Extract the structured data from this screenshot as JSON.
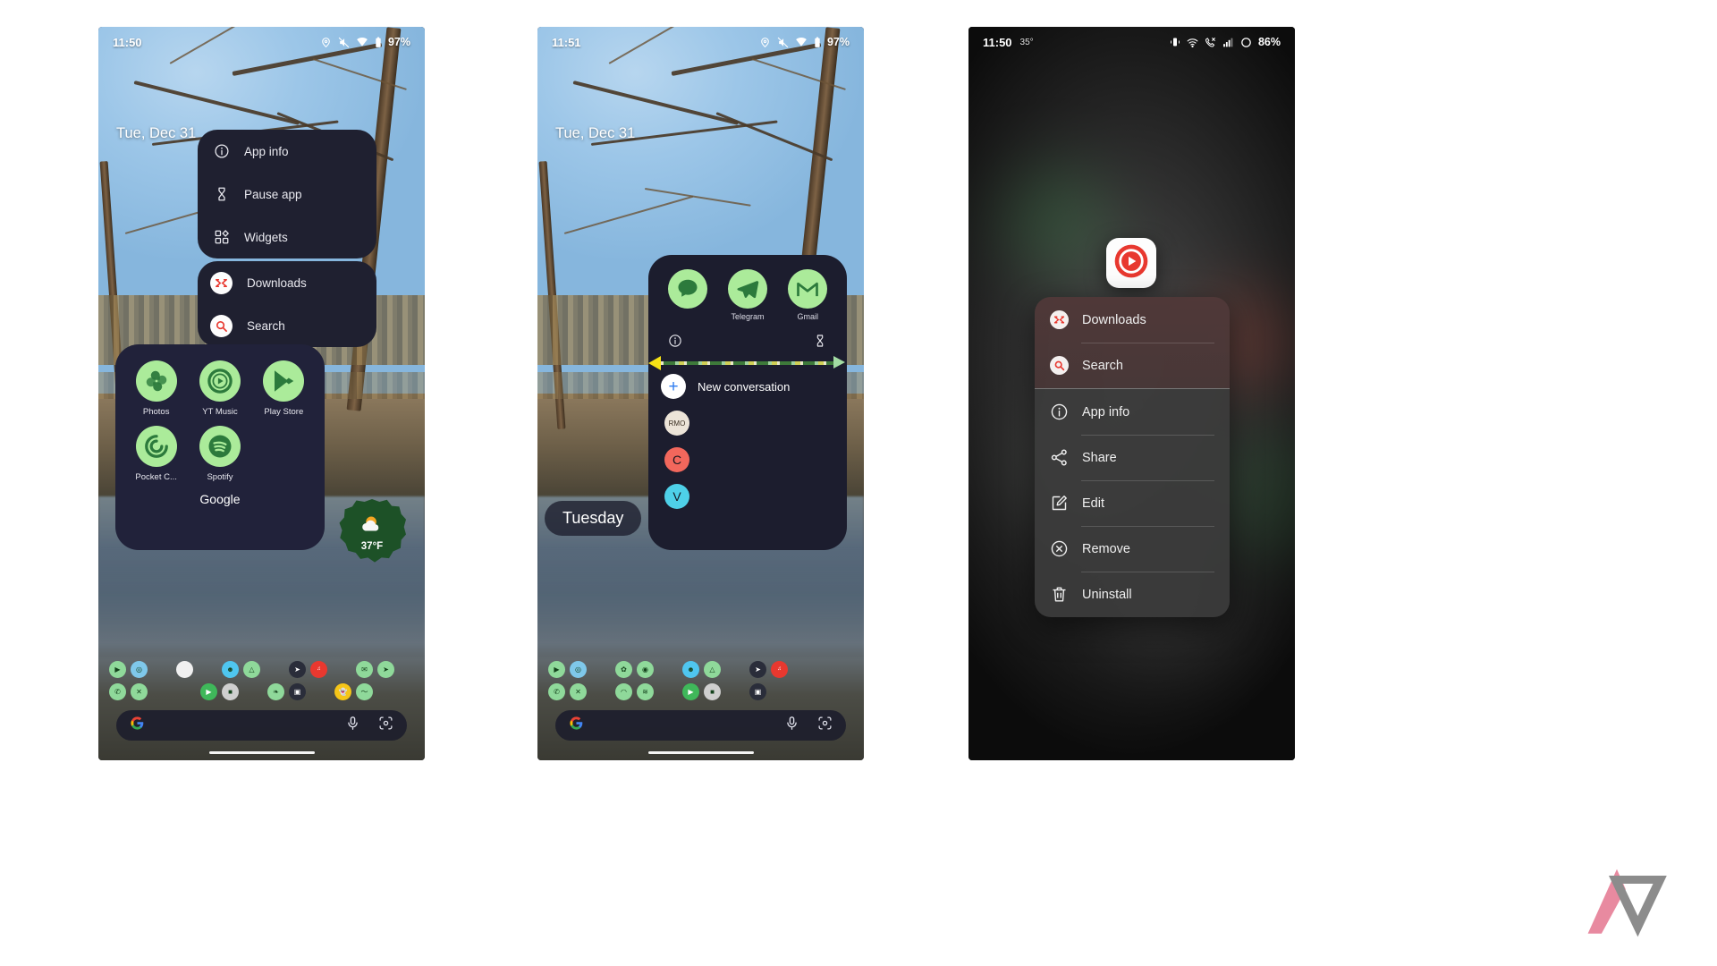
{
  "phone1": {
    "status": {
      "time": "11:50",
      "battery": "97%",
      "icons": [
        "location-icon",
        "mute-icon",
        "wifi-icon",
        "battery-icon"
      ]
    },
    "home_date": "Tue, Dec 31",
    "menu_top": [
      {
        "label": "App info",
        "icon": "info-icon"
      },
      {
        "label": "Pause app",
        "icon": "hourglass-icon"
      },
      {
        "label": "Widgets",
        "icon": "widgets-icon"
      }
    ],
    "menu_bottom": [
      {
        "label": "Downloads",
        "icon": "downloads-shortcut-icon"
      },
      {
        "label": "Search",
        "icon": "search-shortcut-icon"
      }
    ],
    "folder": {
      "title": "Google",
      "apps": [
        {
          "label": "Photos",
          "icon": "google-photos-icon"
        },
        {
          "label": "YT Music",
          "icon": "youtube-music-icon"
        },
        {
          "label": "Play Store",
          "icon": "play-store-icon"
        },
        {
          "label": "Pocket C...",
          "icon": "pocket-casts-icon"
        },
        {
          "label": "Spotify",
          "icon": "spotify-icon"
        }
      ]
    },
    "weather": {
      "temp": "37°F",
      "icon": "sun-cloud-icon",
      "color": "#1d5127"
    },
    "searchbar": {
      "logo": "google-g-icon",
      "mic": "microphone-icon",
      "lens": "google-lens-icon"
    }
  },
  "phone2": {
    "status": {
      "time": "11:51",
      "battery": "97%",
      "icons": [
        "location-icon",
        "mute-icon",
        "wifi-icon",
        "battery-icon"
      ]
    },
    "home_date": "Tue, Dec 31",
    "widget": {
      "apps": [
        {
          "label": "",
          "icon": "messages-icon"
        },
        {
          "label": "Telegram",
          "icon": "telegram-icon"
        },
        {
          "label": "Gmail",
          "icon": "gmail-icon"
        }
      ],
      "tools": [
        {
          "icon": "info-icon"
        },
        {
          "icon": "hourglass-icon"
        }
      ],
      "new_conversation": "New conversation",
      "contacts": [
        {
          "initial": "",
          "color": "#ece4d8",
          "name": "contact-photo"
        },
        {
          "initial": "C",
          "color": "#f2675c",
          "name": "contact-c"
        },
        {
          "initial": "V",
          "color": "#4ed0e8",
          "name": "contact-v"
        }
      ]
    },
    "day_pill": "Tuesday"
  },
  "phone3": {
    "status": {
      "time": "11:50",
      "temp": "35°",
      "battery": "86%",
      "icons": [
        "vibrate-icon",
        "wifi-icon",
        "call-icon",
        "signal-icon",
        "battery-ring-icon"
      ]
    },
    "app_icon": "youtube-music-icon",
    "menu": {
      "shortcuts": [
        {
          "label": "Downloads",
          "icon": "downloads-shortcut-icon"
        },
        {
          "label": "Search",
          "icon": "search-shortcut-icon"
        }
      ],
      "actions": [
        {
          "label": "App info",
          "icon": "info-icon"
        },
        {
          "label": "Share",
          "icon": "share-icon"
        },
        {
          "label": "Edit",
          "icon": "edit-icon"
        },
        {
          "label": "Remove",
          "icon": "remove-icon"
        },
        {
          "label": "Uninstall",
          "icon": "trash-icon"
        }
      ]
    }
  },
  "watermark": {
    "name": "android-police-logo"
  }
}
